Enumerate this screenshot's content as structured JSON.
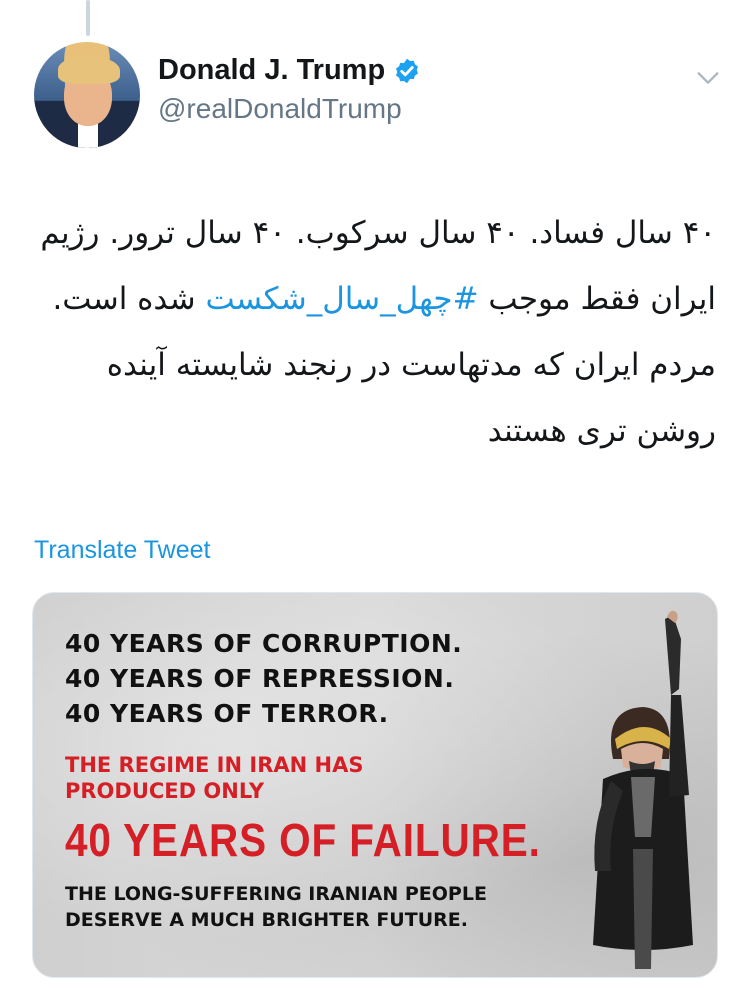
{
  "tweet": {
    "author": {
      "display_name": "Donald J. Trump",
      "handle": "@realDonaldTrump",
      "verified": true,
      "avatar_icon": "profile-avatar"
    },
    "menu_icon": "chevron-down-icon",
    "text": {
      "part1": "۴۰ سال فساد. ۴۰ سال سرکوب. ۴۰ سال ترور. رژیم ایران فقط موجب ",
      "hashtag": "#چهل_سال_شکست",
      "part2": " شده است. مردم ایران که مدتهاست در رنجند شایسته آینده روشن تری هستند"
    },
    "translate_label": "Translate Tweet",
    "media": {
      "line1": "40 YEARS OF CORRUPTION.",
      "line2": "40 YEARS OF REPRESSION.",
      "line3": "40 YEARS OF TERROR.",
      "line4": "THE REGIME IN IRAN HAS",
      "line5": "PRODUCED ONLY",
      "line6": "40 YEARS OF FAILURE.",
      "line7": "THE LONG-SUFFERING IRANIAN PEOPLE",
      "line8": "DESERVE A MUCH BRIGHTER FUTURE."
    }
  },
  "colors": {
    "link": "#1b95e0",
    "text": "#14171a",
    "secondary": "#657786",
    "media_red": "#d51f26"
  }
}
